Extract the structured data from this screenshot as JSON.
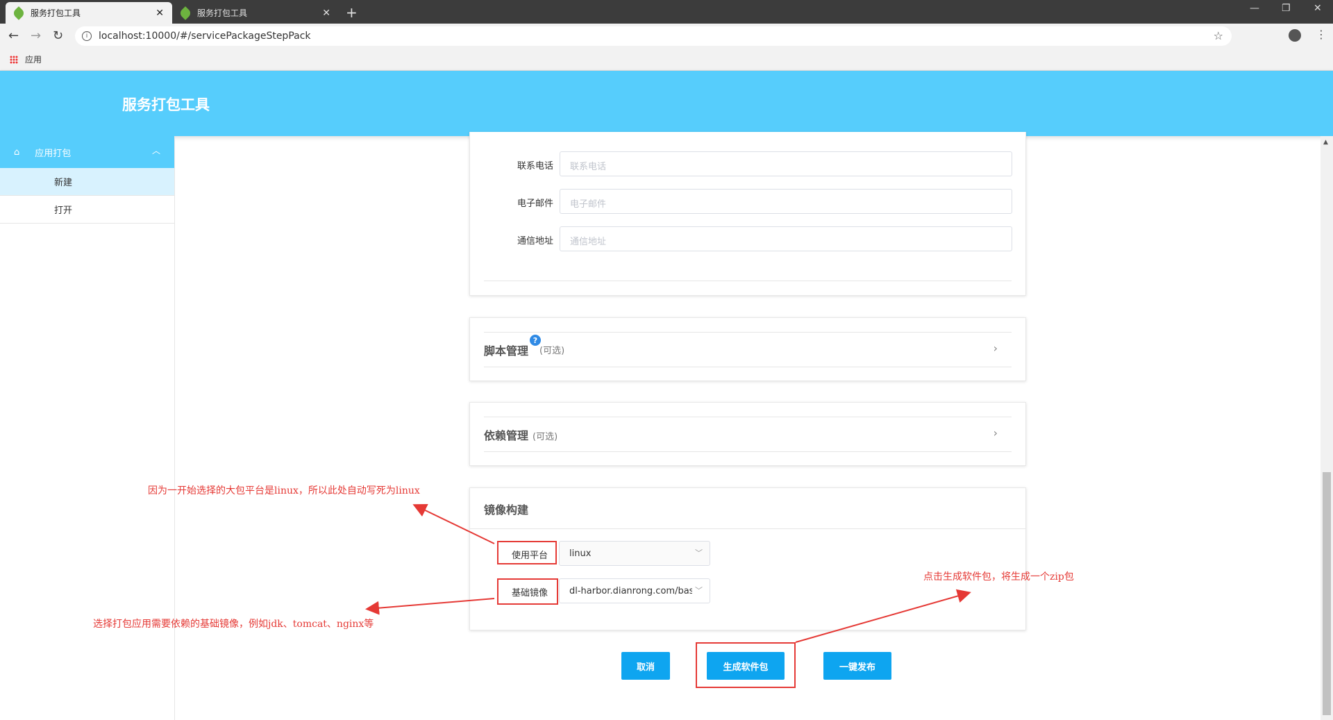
{
  "browser": {
    "tabs": [
      {
        "title": "服务打包工具",
        "active": true
      },
      {
        "title": "服务打包工具",
        "active": false
      }
    ],
    "url": "localhost:10000/#/servicePackageStepPack",
    "bookmarks_label": "应用"
  },
  "app": {
    "title": "服务打包工具",
    "accent_color": "#56cdfc",
    "button_color": "#0ea5f0"
  },
  "sidebar": {
    "group_label": "应用打包",
    "items": [
      {
        "label": "新建",
        "active": true
      },
      {
        "label": "打开",
        "active": false
      }
    ]
  },
  "contact_form": {
    "phone": {
      "label": "联系电话",
      "placeholder": "联系电话"
    },
    "email": {
      "label": "电子邮件",
      "placeholder": "电子邮件"
    },
    "address": {
      "label": "通信地址",
      "placeholder": "通信地址"
    }
  },
  "script_section": {
    "title": "脚本管理",
    "subtitle": "(可选)",
    "help": "?"
  },
  "dependency_section": {
    "title": "依赖管理",
    "subtitle": "(可选)"
  },
  "image_section": {
    "title": "镜像构建",
    "platform": {
      "label": "使用平台",
      "value": "linux"
    },
    "base_image": {
      "label": "基础镜像",
      "value": "dl-harbor.dianrong.com/bas"
    }
  },
  "actions": {
    "cancel": "取消",
    "generate": "生成软件包",
    "publish": "一键发布"
  },
  "annotations": {
    "platform_note": "因为一开始选择的大包平台是linux，所以此处自动写死为linux",
    "image_note": "选择打包应用需要依赖的基础镜像，例如jdk、tomcat、nginx等",
    "generate_note": "点击生成软件包，将生成一个zip包",
    "color": "#e53935"
  }
}
